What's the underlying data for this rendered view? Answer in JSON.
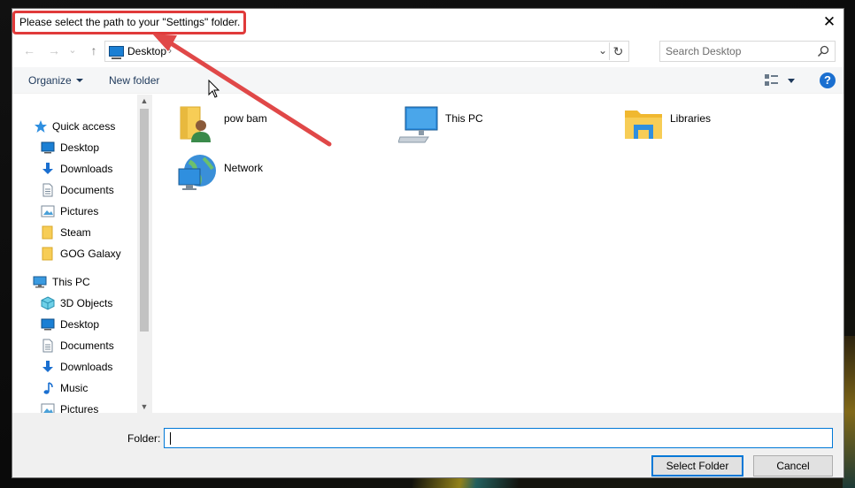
{
  "dialog": {
    "title": "Please select the path to your \"Settings\" folder.",
    "close_glyph": "✕"
  },
  "navigation": {
    "back_glyph": "←",
    "forward_glyph": "→",
    "recent_glyph": "⌄",
    "up_glyph": "↑",
    "address": "Desktop",
    "address_chevron": "›",
    "address_dropdown_glyph": "⌄",
    "refresh_glyph": "↻",
    "search_placeholder": "Search Desktop"
  },
  "toolbar": {
    "organize": "Organize",
    "new_folder": "New folder",
    "help": "?"
  },
  "sidebar": {
    "quick_access": "Quick access",
    "quick_items": [
      {
        "label": "Desktop",
        "icon": "desktop-icon"
      },
      {
        "label": "Downloads",
        "icon": "downloads-icon"
      },
      {
        "label": "Documents",
        "icon": "documents-icon"
      },
      {
        "label": "Pictures",
        "icon": "pictures-icon"
      },
      {
        "label": "Steam",
        "icon": "folder-icon"
      },
      {
        "label": "GOG Galaxy",
        "icon": "folder-icon"
      }
    ],
    "this_pc": "This PC",
    "pc_items": [
      {
        "label": "3D Objects",
        "icon": "3d-objects-icon"
      },
      {
        "label": "Desktop",
        "icon": "desktop-icon"
      },
      {
        "label": "Documents",
        "icon": "documents-icon"
      },
      {
        "label": "Downloads",
        "icon": "downloads-icon"
      },
      {
        "label": "Music",
        "icon": "music-icon"
      },
      {
        "label": "Pictures",
        "icon": "pictures-icon"
      }
    ],
    "scroll_up": "▲",
    "scroll_down": "▼"
  },
  "content": {
    "items": [
      {
        "label": "pow bam",
        "icon": "user-folder-icon"
      },
      {
        "label": "This PC",
        "icon": "computer-icon"
      },
      {
        "label": "Libraries",
        "icon": "libraries-icon"
      },
      {
        "label": "Network",
        "icon": "network-icon"
      }
    ]
  },
  "footer": {
    "folder_label": "Folder:",
    "folder_value": "",
    "select_button": "Select Folder",
    "cancel_button": "Cancel"
  },
  "colors": {
    "annotation": "#e03a3a",
    "accent": "#0078d7",
    "folder_yellow": "#f7cd56"
  }
}
